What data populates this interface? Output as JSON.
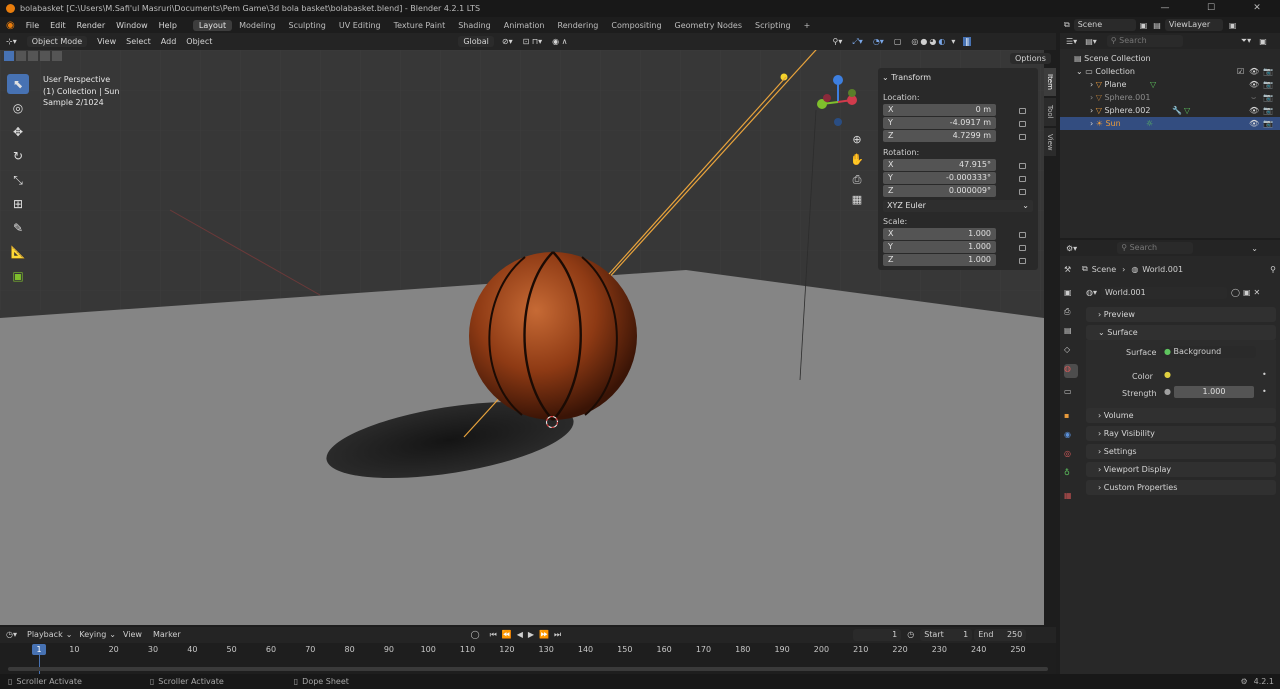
{
  "titlebar": {
    "title": "bolabasket [C:\\Users\\M.Safi'ul Masruri\\Documents\\Pem Game\\3d bola basket\\bolabasket.blend] - Blender 4.2.1 LTS"
  },
  "menu": [
    "File",
    "Edit",
    "Render",
    "Window",
    "Help"
  ],
  "workspaces": [
    "Layout",
    "Modeling",
    "Sculpting",
    "UV Editing",
    "Texture Paint",
    "Shading",
    "Animation",
    "Rendering",
    "Compositing",
    "Geometry Nodes",
    "Scripting"
  ],
  "active_workspace": "Layout",
  "topright": {
    "scene": "Scene",
    "view_layer": "ViewLayer"
  },
  "viewport_header": {
    "mode": "Object Mode",
    "menus": [
      "View",
      "Select",
      "Add",
      "Object"
    ],
    "orientation": "Global",
    "options": "Options"
  },
  "viewport_info": {
    "line1": "User Perspective",
    "line2": "(1) Collection | Sun",
    "line3": "Sample 2/1024"
  },
  "npanel": {
    "title": "Transform",
    "location_label": "Location:",
    "location": [
      {
        "axis": "X",
        "value": "0 m"
      },
      {
        "axis": "Y",
        "value": "-4.0917 m"
      },
      {
        "axis": "Z",
        "value": "4.7299 m"
      }
    ],
    "rotation_label": "Rotation:",
    "rotation": [
      {
        "axis": "X",
        "value": "47.915°"
      },
      {
        "axis": "Y",
        "value": "-0.000333°"
      },
      {
        "axis": "Z",
        "value": "0.000009°"
      }
    ],
    "rotation_mode": "XYZ Euler",
    "scale_label": "Scale:",
    "scale": [
      {
        "axis": "X",
        "value": "1.000"
      },
      {
        "axis": "Y",
        "value": "1.000"
      },
      {
        "axis": "Z",
        "value": "1.000"
      }
    ],
    "tabs": [
      "Item",
      "Tool",
      "View"
    ]
  },
  "outliner": {
    "search_placeholder": "Search",
    "rows": [
      {
        "label": "Scene Collection"
      },
      {
        "label": "Collection"
      },
      {
        "label": "Plane"
      },
      {
        "label": "Sphere.001"
      },
      {
        "label": "Sphere.002"
      },
      {
        "label": "Sun"
      }
    ]
  },
  "properties": {
    "search_placeholder": "Search",
    "breadcrumb_scene": "Scene",
    "breadcrumb_world": "World.001",
    "world_name": "World.001",
    "sections": [
      "Preview",
      "Surface",
      "Volume",
      "Ray Visibility",
      "Settings",
      "Viewport Display",
      "Custom Properties"
    ],
    "surface_label": "Surface",
    "surface_value": "Background",
    "color_label": "Color",
    "strength_label": "Strength",
    "strength_value": "1.000"
  },
  "timeline": {
    "menus": [
      "Playback",
      "Keying",
      "View",
      "Marker"
    ],
    "current_frame": "1",
    "start_label": "Start",
    "start": "1",
    "end_label": "End",
    "end": "250",
    "ticks": [
      "1",
      "10",
      "20",
      "30",
      "40",
      "50",
      "60",
      "70",
      "80",
      "90",
      "100",
      "110",
      "120",
      "130",
      "140",
      "150",
      "160",
      "170",
      "180",
      "190",
      "200",
      "210",
      "220",
      "230",
      "240",
      "250"
    ]
  },
  "statusbar": {
    "item1": "Scroller Activate",
    "item2": "Scroller Activate",
    "item3": "Dope Sheet",
    "version": "4.2.1"
  },
  "colors": {
    "accent": "#4772b3",
    "selected_row": "#334d80",
    "ball": "#a84a1c",
    "sun_line": "#e8a33c"
  }
}
